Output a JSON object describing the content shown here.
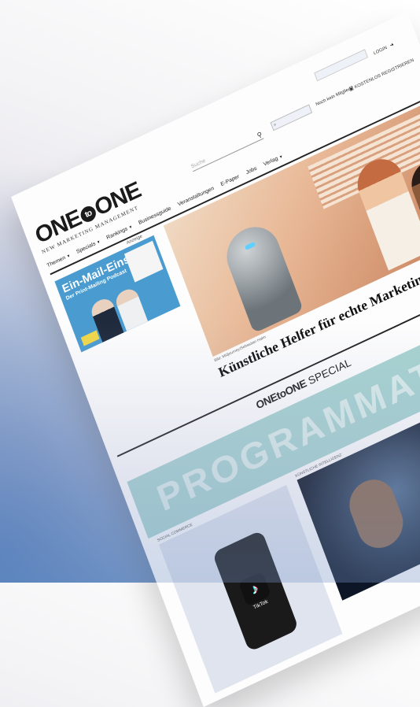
{
  "header": {
    "logo_text": "ONE to ONE",
    "logo_tagline": "NEW MARKETING MANAGEMENT",
    "search_placeholder": "Suche",
    "not_member": "Noch kein Mitglied?",
    "register": "KOSTENLOS REGISTRIEREN",
    "login": "LOGIN"
  },
  "nav": {
    "items": [
      {
        "label": "Themen",
        "dropdown": true
      },
      {
        "label": "Specials",
        "dropdown": true
      },
      {
        "label": "Rankings",
        "dropdown": true
      },
      {
        "label": "Businessguide",
        "dropdown": false
      },
      {
        "label": "Veranstaltungen",
        "dropdown": false
      },
      {
        "label": "E-Paper",
        "dropdown": false
      },
      {
        "label": "Jobs",
        "dropdown": false
      },
      {
        "label": "Verlag",
        "dropdown": true
      }
    ]
  },
  "ad": {
    "label": "Anzeige",
    "title": "Ein-Mail-Eins",
    "subtitle": "Der Print-Mailing Podcast"
  },
  "hero": {
    "credit": "Bild: Midjourney/Sebastian Halm",
    "title": "Künstliche Helfer für echte Marketing-Au"
  },
  "special": {
    "brand": "ONEtoONE",
    "label": "SPECIAL",
    "banner": "PROGRAMMATIC PRIN"
  },
  "cards": [
    {
      "category": "SOCIAL COMMERCE",
      "logo_text": "TikTok"
    },
    {
      "category": "KÜNSTLICHE INTELLIGENZ"
    }
  ],
  "icons": {
    "search": "search-icon",
    "login": "login-icon",
    "register": "register-icon"
  },
  "colors": {
    "background_blue": "#6f94c2",
    "special_band": "#a7d3d1",
    "ad_blue": "#4a9bd0"
  }
}
